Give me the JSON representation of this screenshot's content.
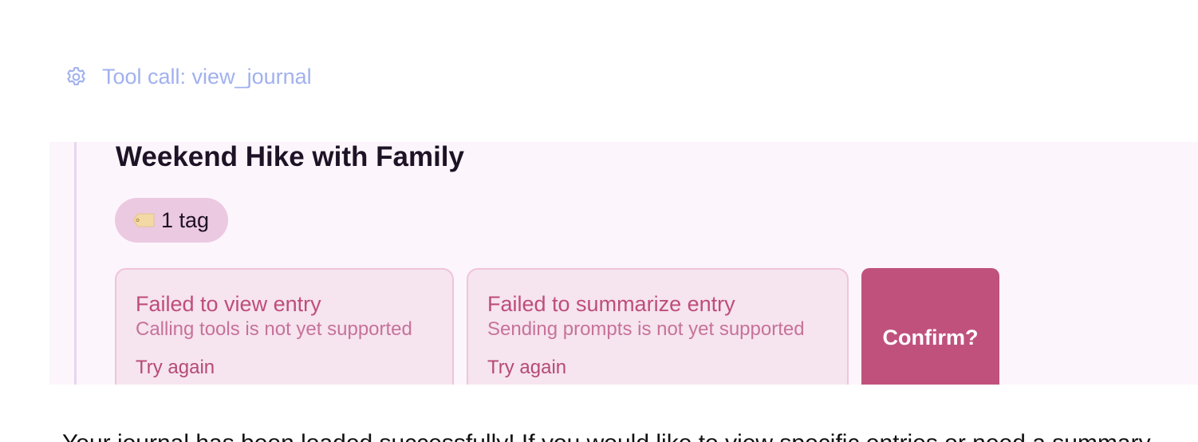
{
  "tool_call": {
    "label": "Tool call: view_journal",
    "icon": "gear-icon"
  },
  "entry": {
    "title": "Weekend Hike with Family",
    "tag_chip": {
      "icon": "tag-icon",
      "label": "1 tag"
    }
  },
  "cards": [
    {
      "title": "Failed to view entry",
      "message": "Calling tools is not yet supported",
      "retry": "Try again"
    },
    {
      "title": "Failed to summarize entry",
      "message": "Sending prompts is not yet supported",
      "retry": "Try again"
    }
  ],
  "confirm": {
    "label": "Confirm?"
  },
  "assistant_message": "Your journal has been loaded successfully! If you would like to view specific entries or need a summary",
  "colors": {
    "tool_call_text": "#a1b1ee",
    "panel_bg": "#fdf5fc",
    "chip_bg": "#ebc9e1",
    "card_bg": "#f6e4ef",
    "error_title": "#be4d7b",
    "confirm_bg": "#c0517d"
  }
}
